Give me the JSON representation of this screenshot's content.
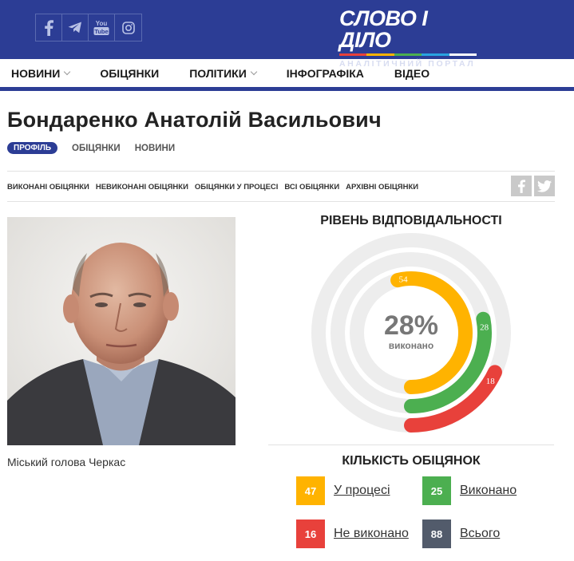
{
  "header": {
    "social": [
      {
        "icon": "facebook-icon",
        "glyph": "f"
      },
      {
        "icon": "telegram-icon",
        "glyph": "➤"
      },
      {
        "icon": "youtube-icon",
        "glyph": "You\nTube"
      },
      {
        "icon": "instagram-icon",
        "glyph": "◎"
      }
    ],
    "logo": {
      "word": "СЛОВО І ДІЛО",
      "tagline": "АНАЛІТИЧНИЙ ПОРТАЛ"
    }
  },
  "nav": {
    "items": [
      {
        "label": "НОВИНИ",
        "dropdown": true
      },
      {
        "label": "ОБІЦЯНКИ",
        "dropdown": false
      },
      {
        "label": "ПОЛІТИКИ",
        "dropdown": true
      },
      {
        "label": "ІНФОГРАФІКА",
        "dropdown": false
      },
      {
        "label": "ВІДЕО",
        "dropdown": false
      }
    ]
  },
  "profile": {
    "name": "Бондаренко Анатолій Васильович",
    "tabs": {
      "active": "ПРОФІЛЬ",
      "promises": "ОБІЦЯНКИ",
      "news": "НОВИНИ"
    },
    "filters": [
      "ВИКОНАНІ ОБІЦЯНКИ",
      "НЕВИКОНАНІ ОБІЦЯНКИ",
      "ОБІЦЯНКИ У ПРОЦЕСІ",
      "ВСІ ОБІЦЯНКИ",
      "АРХІВНІ ОБІЦЯНКИ"
    ],
    "caption": "Міський голова Черкас"
  },
  "chart_data": {
    "type": "radial-bar",
    "title": "РІВЕНЬ ВІДПОВІДАЛЬНОСТІ",
    "center_value": "28%",
    "center_label": "виконано",
    "series": [
      {
        "value": 18,
        "color": "#e8413b"
      },
      {
        "value": 28,
        "color": "#4caf50"
      },
      {
        "value": 54,
        "color": "#ffb300"
      }
    ]
  },
  "counts": {
    "title": "КІЛЬКІСТЬ ОБІЦЯНОК",
    "items": [
      {
        "value": "47",
        "label": "У процесі",
        "color": "#ffb300"
      },
      {
        "value": "25",
        "label": "Виконано",
        "color": "#4caf50"
      },
      {
        "value": "16",
        "label": "Не виконано",
        "color": "#e8413b"
      },
      {
        "value": "88",
        "label": "Всього",
        "color": "#525b6b"
      }
    ]
  },
  "colors": {
    "brand": "#2c3d95",
    "track": "#ededed"
  }
}
